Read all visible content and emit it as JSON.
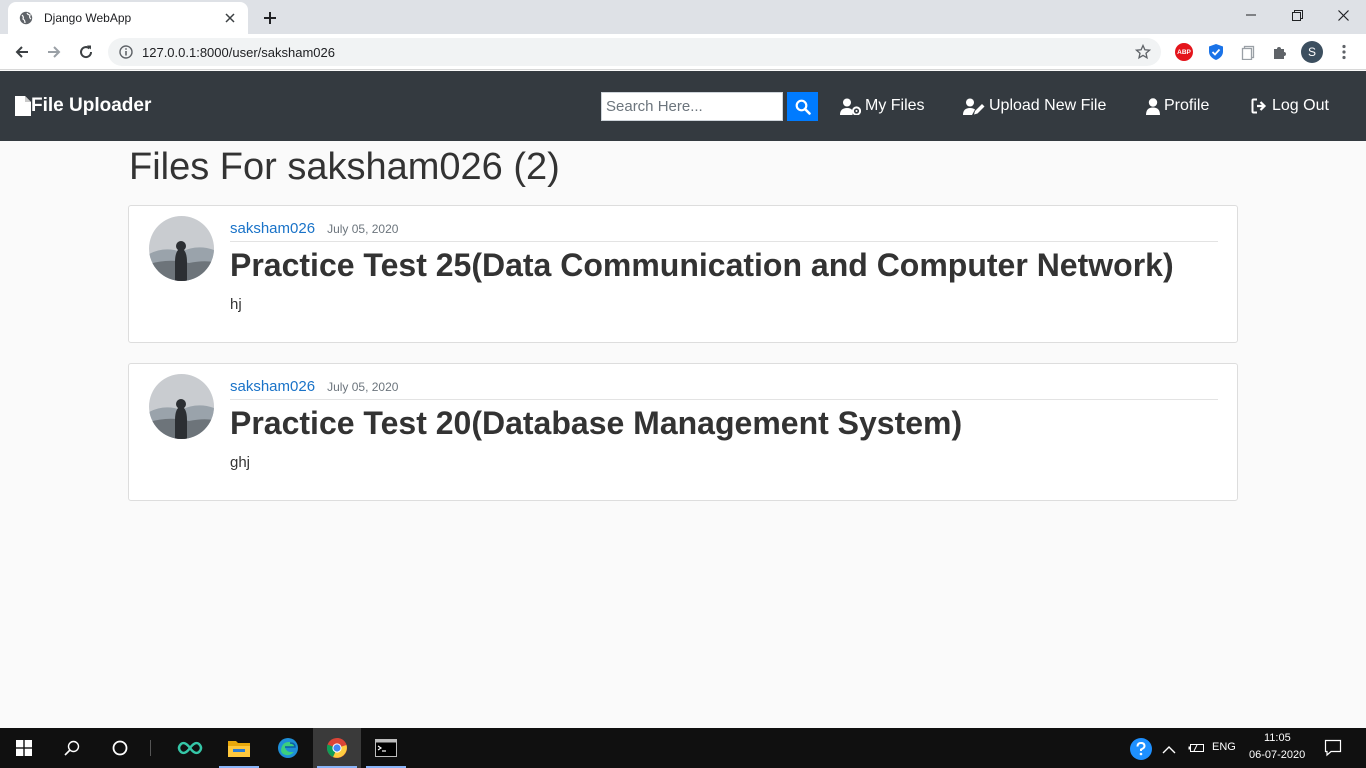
{
  "browser": {
    "tab_title": "Django WebApp",
    "url": "127.0.0.1:8000/user/saksham026",
    "profile_initial": "S",
    "abp_label": "ABP"
  },
  "site": {
    "brand": "File Uploader",
    "search_placeholder": "Search Here...",
    "nav": {
      "my_files": "My Files",
      "upload": "Upload New File",
      "profile": "Profile",
      "logout": "Log Out"
    },
    "colors": {
      "navbar": "#343a40",
      "accent": "#007bff",
      "link": "#1a73c8"
    }
  },
  "page": {
    "title": "Files For saksham026 (2)",
    "posts": [
      {
        "author": "saksham026",
        "date": "July 05, 2020",
        "title": "Practice Test 25(Data Communication and Computer Network)",
        "body": "hj"
      },
      {
        "author": "saksham026",
        "date": "July 05, 2020",
        "title": "Practice Test 20(Database Management System)",
        "body": "ghj"
      }
    ]
  },
  "taskbar": {
    "language": "ENG",
    "time": "11:05",
    "date": "06-07-2020",
    "apps": [
      "start-icon",
      "search-icon",
      "cortana-icon",
      "infinity-app-icon",
      "file-explorer-icon",
      "edge-icon",
      "chrome-icon",
      "terminal-icon"
    ]
  }
}
